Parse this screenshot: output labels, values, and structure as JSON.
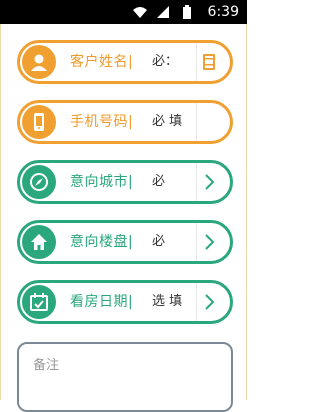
{
  "status_bar": {
    "time": "6:39",
    "icons": [
      "wifi-icon",
      "signal-icon",
      "battery-icon"
    ]
  },
  "form": {
    "rows": [
      {
        "icon": "person-icon",
        "label": "客户姓名|",
        "value": "必：",
        "trail_icon": "contact-book-icon",
        "color": "#f0a030"
      },
      {
        "icon": "phone-icon",
        "label": "手机号码|",
        "value": "必 填",
        "trail_icon": "",
        "color": "#f0a030"
      },
      {
        "icon": "compass-icon",
        "label": "意向城市|",
        "value": "必",
        "trail_icon": "chevron-right-icon",
        "color": "#2aa77d"
      },
      {
        "icon": "home-icon",
        "label": "意向楼盘|",
        "value": "必",
        "trail_icon": "chevron-right-icon",
        "color": "#2aa77d"
      },
      {
        "icon": "calendar-icon",
        "label": "看房日期|",
        "value": "选 填",
        "trail_icon": "chevron-right-icon",
        "color": "#2aa77d"
      }
    ],
    "notes_placeholder": "备注"
  }
}
